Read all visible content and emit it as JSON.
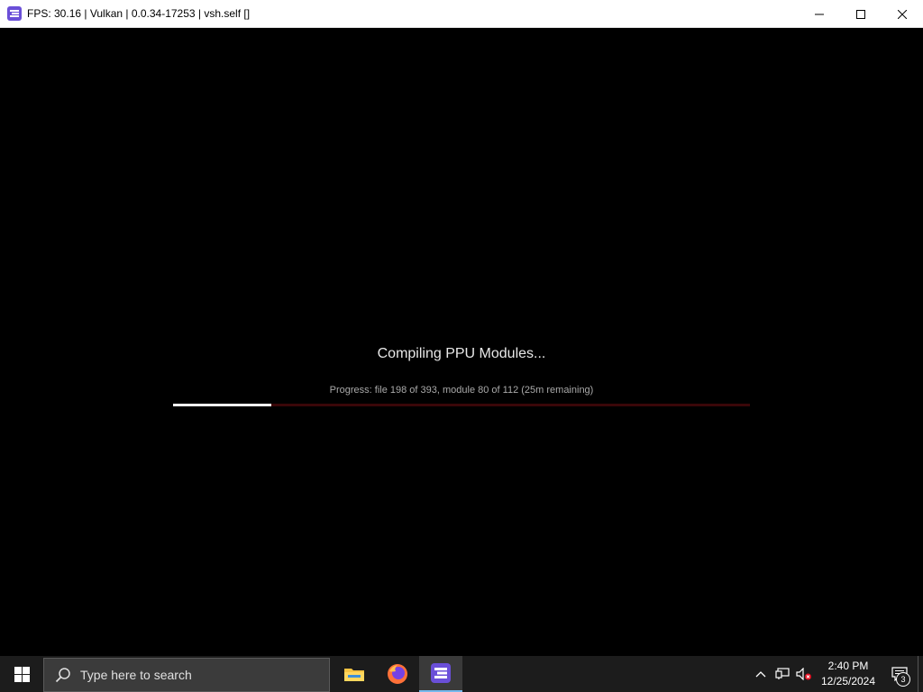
{
  "window": {
    "title": "FPS: 30.16 | Vulkan | 0.0.34-17253 | vsh.self []",
    "app_icon": "rpcs3-icon",
    "controls": [
      "minimize-icon",
      "maximize-icon",
      "close-icon"
    ]
  },
  "compile": {
    "title": "Compiling PPU Modules...",
    "progress_text": "Progress: file 198 of 393, module 80 of 112 (25m remaining)",
    "progress_fraction": 0.17,
    "track_color": "#3a0708",
    "fill_color": "#f2f2f2"
  },
  "taskbar": {
    "search_placeholder": "Type here to search",
    "apps": [
      "file-explorer-icon",
      "firefox-icon",
      "rpcs3-icon"
    ],
    "active_app": "rpcs3-icon",
    "tray_icons": [
      "chevron-up-icon",
      "network-icon",
      "volume-muted-icon"
    ],
    "time": "2:40 PM",
    "date": "12/25/2024",
    "notification_count": "3"
  }
}
